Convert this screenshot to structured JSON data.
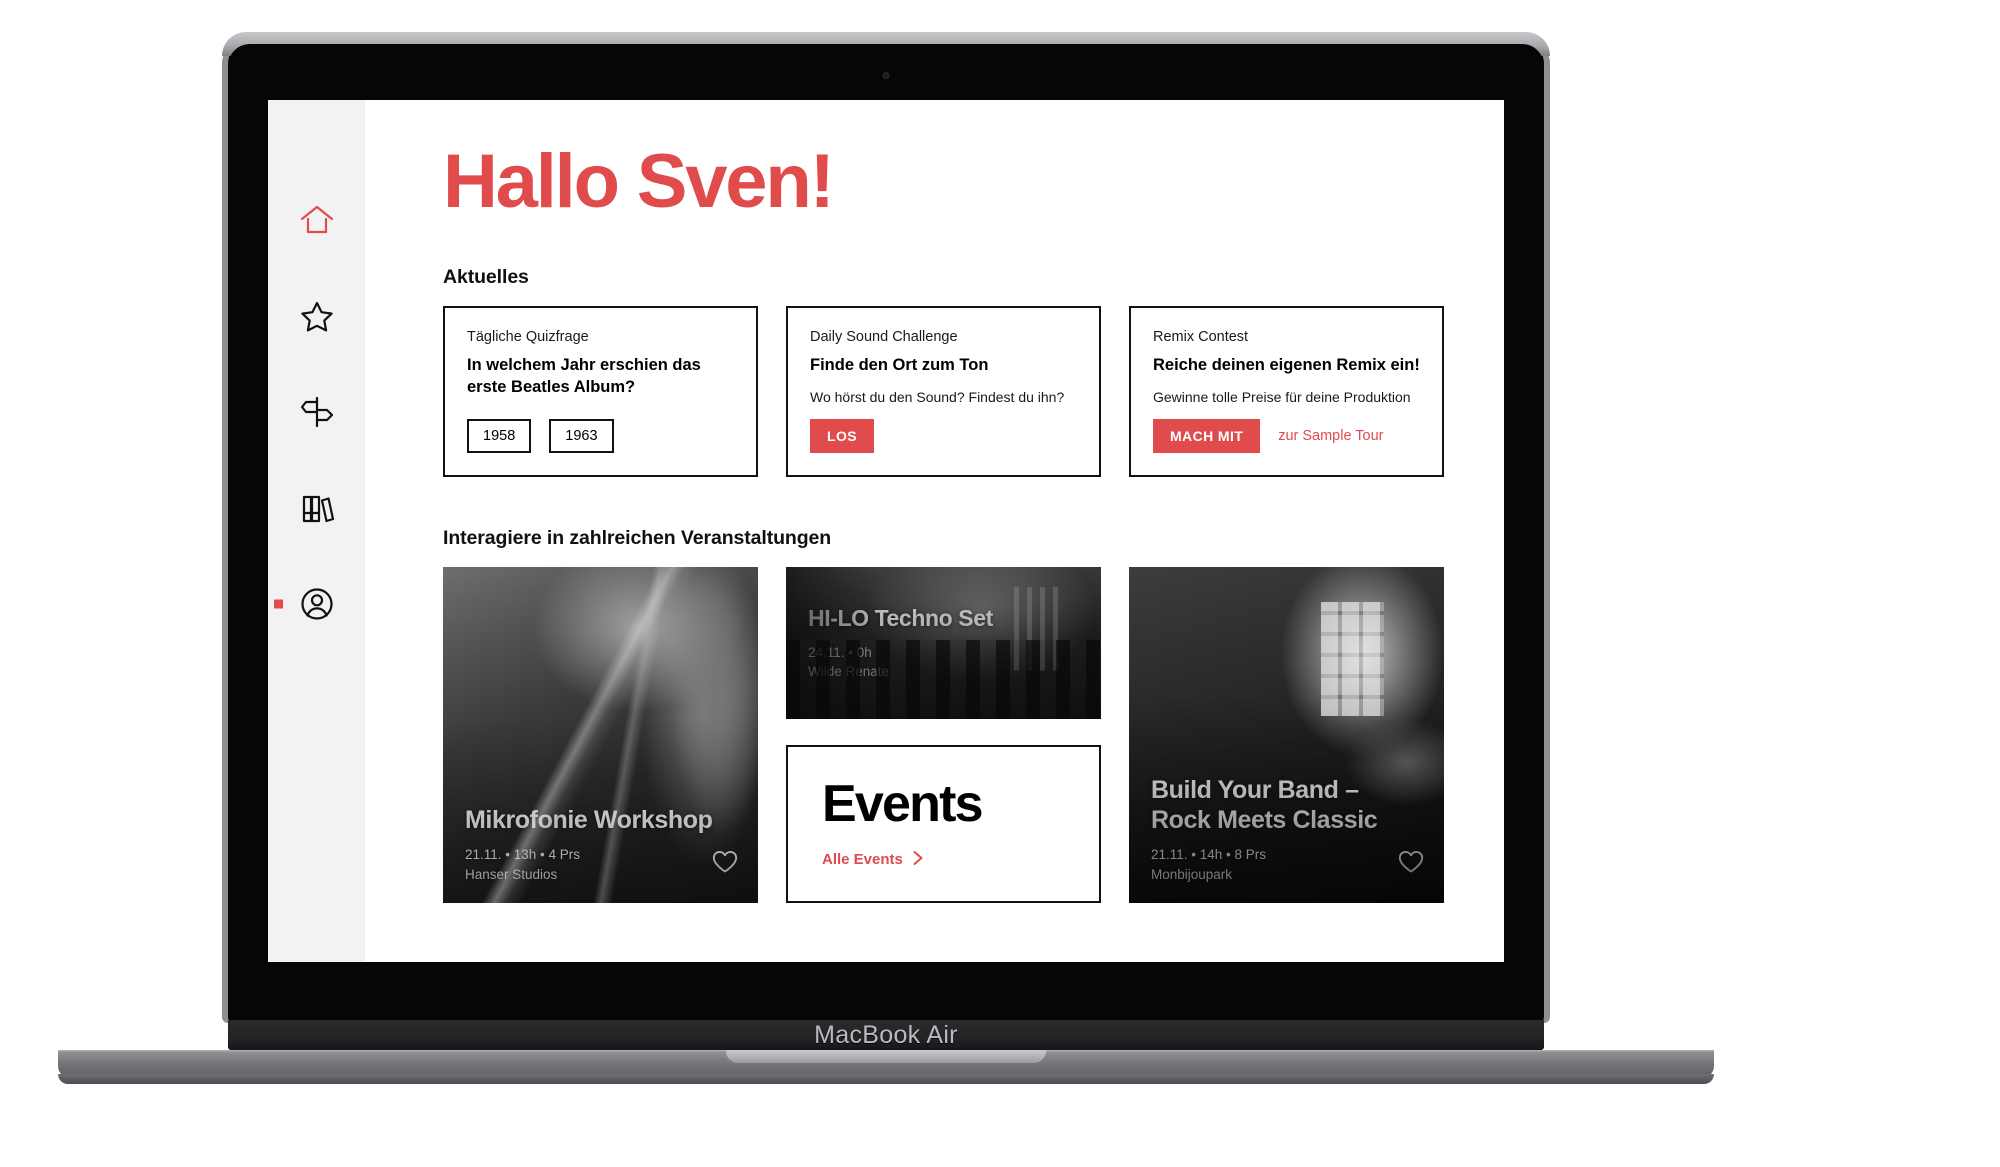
{
  "device": {
    "brand_label": "MacBook Air",
    "camera_icon": "camera-dot-icon"
  },
  "colors": {
    "accent": "#e04b4b",
    "sidebar_bg": "#f2f2f2",
    "ink": "#111111",
    "page_bg": "#ffffff"
  },
  "sidebar": {
    "items": [
      {
        "name": "home",
        "icon": "home-icon",
        "active": true
      },
      {
        "name": "favorites",
        "icon": "star-icon",
        "active": false
      },
      {
        "name": "discover",
        "icon": "signpost-icon",
        "active": false
      },
      {
        "name": "library",
        "icon": "books-icon",
        "active": false
      },
      {
        "name": "profile",
        "icon": "user-circle-icon",
        "active": false,
        "has_dot": true
      }
    ]
  },
  "header": {
    "greeting": "Hallo Sven!"
  },
  "news": {
    "section_title": "Aktuelles",
    "cards": [
      {
        "kicker": "Tägliche Quizfrage",
        "title": "In welchem Jahr erschien das erste Beatles Album?",
        "subtitle": "",
        "answers": [
          "1958",
          "1963"
        ],
        "cta": "",
        "link": ""
      },
      {
        "kicker": "Daily Sound Challenge",
        "title": "Finde den Ort zum Ton",
        "subtitle": "Wo hörst du den Sound? Findest du ihn?",
        "answers": [],
        "cta": "LOS",
        "link": ""
      },
      {
        "kicker": "Remix Contest",
        "title": "Reiche deinen eigenen Remix ein!",
        "subtitle": "Gewinne tolle Preise für deine Produktion",
        "answers": [],
        "cta": "MACH MIT",
        "link": "zur Sample Tour"
      }
    ]
  },
  "events": {
    "section_title": "Interagiere in zahlreichen Veranstaltungen",
    "cards": [
      {
        "title": "Mikrofonie Workshop",
        "date": "21.11. • 13h • 4 Prs",
        "venue": "Hanser Studios",
        "favorite_icon": "heart-icon",
        "photo": "microphone"
      },
      {
        "title": "HI-LO Techno Set",
        "date": "24.11. • 0h",
        "venue": "Wilde Renate",
        "favorite_icon": "",
        "photo": "crowd"
      },
      {
        "title": "Build Your Band  – Rock Meets Classic",
        "date": "21.11. • 14h • 8 Prs",
        "venue": "Monbijoupark",
        "favorite_icon": "heart-icon",
        "photo": "stage"
      }
    ],
    "promo": {
      "title": "Events",
      "link_label": "Alle Events",
      "link_icon": "chevron-right-icon"
    }
  }
}
